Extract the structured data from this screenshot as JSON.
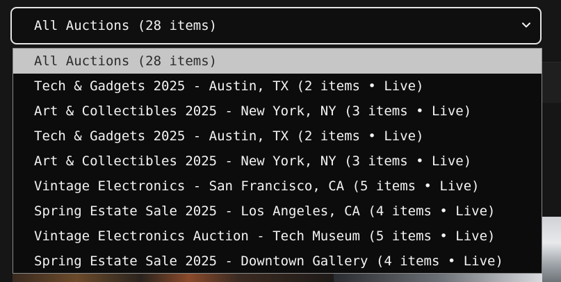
{
  "auction_filter": {
    "selected_label": "All Auctions (28 items)",
    "options": [
      "All Auctions (28 items)",
      "Tech & Gadgets 2025 - Austin, TX (2 items • Live)",
      "Art & Collectibles 2025 - New York, NY (3 items • Live)",
      "Tech & Gadgets 2025 - Austin, TX (2 items • Live)",
      "Art & Collectibles 2025 - New York, NY (3 items • Live)",
      "Vintage Electronics - San Francisco, CA (5 items • Live)",
      "Spring Estate Sale 2025 - Los Angeles, CA (4 items • Live)",
      "Vintage Electronics Auction - Tech Museum (5 items • Live)",
      "Spring Estate Sale 2025 - Downtown Gallery (4 items • Live)"
    ],
    "highlighted_index": 0,
    "chevron_icon": "chevron-down-icon"
  },
  "colors": {
    "background": "#161616",
    "list_background": "#0c0c0c",
    "highlight": "#c6c6c6",
    "border": "#e6e6e6"
  }
}
